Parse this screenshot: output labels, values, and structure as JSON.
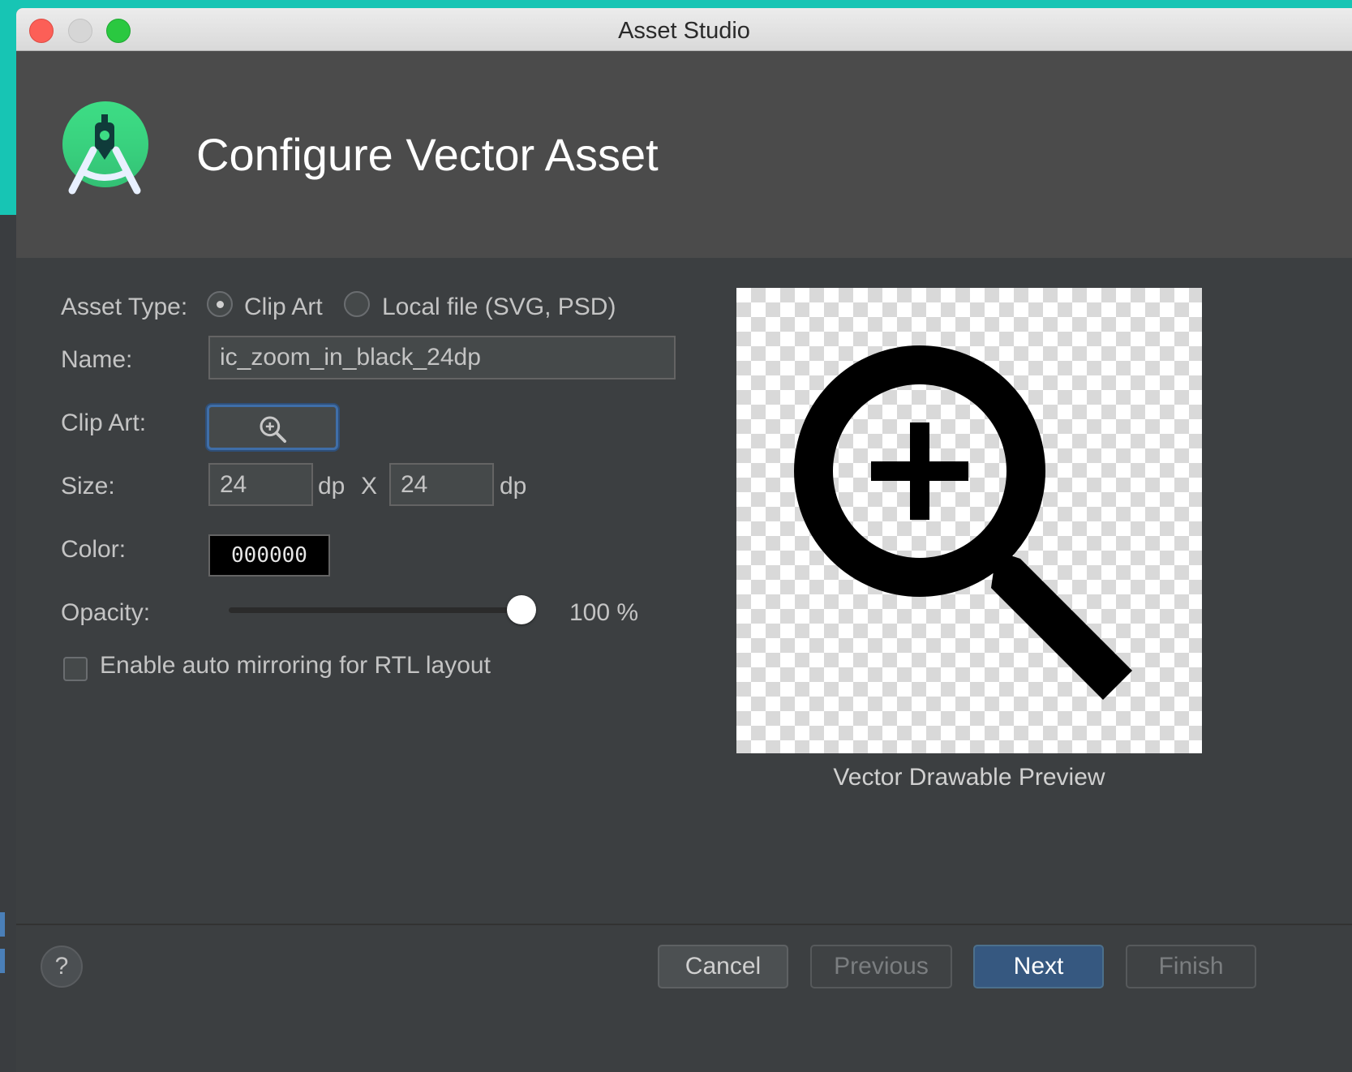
{
  "window": {
    "title": "Asset Studio"
  },
  "header": {
    "title": "Configure Vector Asset",
    "logo_icon": "android-studio-logo-icon"
  },
  "form": {
    "asset_type": {
      "label": "Asset Type:",
      "options": [
        {
          "label": "Clip Art",
          "selected": true
        },
        {
          "label": "Local file (SVG, PSD)",
          "selected": false
        }
      ]
    },
    "name": {
      "label": "Name:",
      "value": "ic_zoom_in_black_24dp"
    },
    "clip_art": {
      "label": "Clip Art:",
      "icon": "zoom-in-icon"
    },
    "size": {
      "label": "Size:",
      "width": "24",
      "height": "24",
      "unit": "dp",
      "separator": "X"
    },
    "color": {
      "label": "Color:",
      "value": "000000"
    },
    "opacity": {
      "label": "Opacity:",
      "value_text": "100 %",
      "value_percent": 100
    },
    "auto_mirror": {
      "label": "Enable auto mirroring for RTL layout",
      "checked": false
    }
  },
  "preview": {
    "caption": "Vector Drawable Preview",
    "icon": "zoom-in-icon"
  },
  "footer": {
    "help_label": "?",
    "cancel_label": "Cancel",
    "previous_label": "Previous",
    "next_label": "Next",
    "finish_label": "Finish"
  },
  "colors": {
    "dialog_bg": "#3c3f41",
    "header_bg": "#4b4b4b",
    "primary_button": "#365880",
    "desktop_accent": "#17c5b4"
  }
}
